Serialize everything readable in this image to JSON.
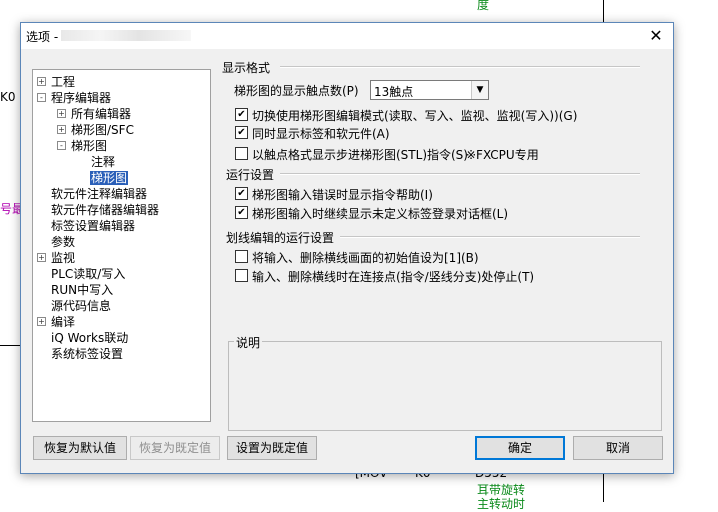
{
  "background": {
    "top_label": "度",
    "left_k0": "K0",
    "left_purple": "号最",
    "bottom_mov": "[MOV",
    "bottom_k0": "K0",
    "bottom_d": "D552",
    "bottom_green1": "耳带旋转",
    "bottom_green2": "主转动时"
  },
  "dialog": {
    "title_prefix": "选项 -",
    "close_glyph": "✕"
  },
  "tree": {
    "items": [
      {
        "label": "工程",
        "toggle": "+"
      },
      {
        "label": "程序编辑器",
        "toggle": "-"
      },
      {
        "label": "所有编辑器",
        "toggle": "+"
      },
      {
        "label": "梯形图/SFC",
        "toggle": "+"
      },
      {
        "label": "梯形图",
        "toggle": "-"
      },
      {
        "label": "注释",
        "toggle": ""
      },
      {
        "label": "梯形图",
        "toggle": ""
      },
      {
        "label": "软元件注释编辑器",
        "toggle": ""
      },
      {
        "label": "软元件存储器编辑器",
        "toggle": ""
      },
      {
        "label": "标签设置编辑器",
        "toggle": ""
      },
      {
        "label": "参数",
        "toggle": ""
      },
      {
        "label": "监视",
        "toggle": "+"
      },
      {
        "label": "PLC读取/写入",
        "toggle": ""
      },
      {
        "label": "RUN中写入",
        "toggle": ""
      },
      {
        "label": "源代码信息",
        "toggle": ""
      },
      {
        "label": "编译",
        "toggle": "+"
      },
      {
        "label": "iQ Works联动",
        "toggle": ""
      },
      {
        "label": "系统标签设置",
        "toggle": ""
      }
    ]
  },
  "display_format": {
    "title": "显示格式",
    "contact_count_label": "梯形图的显示触点数(P)",
    "contact_count_value": "13触点",
    "options": [
      {
        "label": "切换使用梯形图编辑模式(读取、写入、监视、监视(写入))(G)",
        "checked": true
      },
      {
        "label": "同时显示标签和软元件(A)",
        "checked": true
      },
      {
        "label": "以触点格式显示步进梯形图(STL)指令(S)",
        "checked": false
      }
    ],
    "fxcpu_note": "※FXCPU专用"
  },
  "run_settings": {
    "title": "运行设置",
    "options": [
      {
        "label": "梯形图输入错误时显示指令帮助(I)",
        "checked": true
      },
      {
        "label": "梯形图输入时继续显示未定义标签登录对话框(L)",
        "checked": true
      }
    ]
  },
  "line_edit": {
    "title": "划线编辑的运行设置",
    "options": [
      {
        "label": "将输入、删除横线画面的初始值设为[1](B)",
        "checked": false
      },
      {
        "label": "输入、删除横线时在连接点(指令/竖线分支)处停止(T)",
        "checked": false
      }
    ]
  },
  "description": {
    "title": "说明"
  },
  "buttons": {
    "restore_default": "恢复为默认值",
    "restore_preset": "恢复为既定值",
    "set_preset": "设置为既定值",
    "ok": "确定",
    "cancel": "取消"
  },
  "colors": {
    "selection": "#2a5fb8",
    "background_green": "#0a8a1a",
    "background_purple": "#b000b0"
  }
}
